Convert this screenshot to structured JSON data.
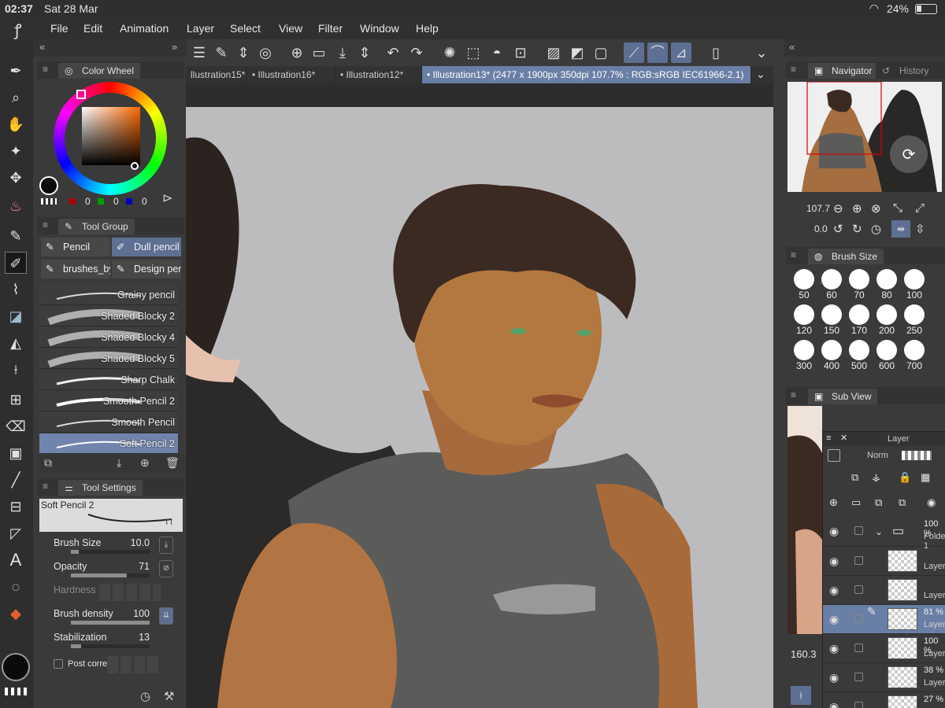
{
  "status": {
    "time": "02:37",
    "date": "Sat 28 Mar",
    "battery": "24%"
  },
  "menu": [
    "File",
    "Edit",
    "Animation",
    "Layer",
    "Select",
    "View",
    "Filter",
    "Window",
    "Help"
  ],
  "tabs": [
    "llustration15*",
    "Illustration16*",
    "Illustration12*",
    "Illustration13* (2477 x 1900px 350dpi 107.7% : RGB:sRGB IEC61966-2.1)"
  ],
  "color_wheel": {
    "title": "Color Wheel",
    "r": "0",
    "g": "0",
    "b": "0",
    "r_color": "#b00000",
    "g_color": "#00a000",
    "b_color": "#0000c0",
    "main_color": "#0b0b0b"
  },
  "tool_group": {
    "title": "Tool Group",
    "items": [
      "Pencil",
      "Dull pencil",
      "brushes_by",
      "Design pen"
    ],
    "brushes": [
      "Grainy pencil",
      "Shaded Blocky 2",
      "Shaded Blocky 4",
      "Shaded Blocky 5",
      "Sharp Chalk",
      "Smooth Pencil 2",
      "Smooth Pencil",
      "Soft Pencil 2"
    ]
  },
  "tool_settings": {
    "title": "Tool Settings",
    "preview_name": "Soft Pencil 2",
    "brush_size_label": "Brush Size",
    "brush_size": "10.0",
    "brush_size_frac": 0.1,
    "opacity_label": "Opacity",
    "opacity": "71",
    "opacity_frac": 0.71,
    "hardness_label": "Hardness",
    "density_label": "Brush density",
    "density": "100",
    "density_frac": 1.0,
    "stabilization_label": "Stabilization",
    "stabilization": "13",
    "stabilization_frac": 0.13,
    "post_label": "Post correc"
  },
  "navigator": {
    "title": "Navigator",
    "history": "History",
    "zoom": "107.7",
    "angle": "0.0"
  },
  "brush_size_panel": {
    "title": "Brush Size",
    "sizes": [
      "50",
      "60",
      "70",
      "80",
      "100",
      "120",
      "150",
      "170",
      "200",
      "250",
      "300",
      "400",
      "500",
      "600",
      "700"
    ]
  },
  "sub_view": {
    "title": "Sub View",
    "value": "160.3"
  },
  "layers": {
    "title": "Layer",
    "blend": "Norm",
    "folder": {
      "pct": "100 %",
      "name": "Folder 1"
    },
    "rows": [
      {
        "pct": "",
        "name": "Layer"
      },
      {
        "pct": "",
        "name": "Layer"
      },
      {
        "pct": "81 %",
        "name": "Layer"
      },
      {
        "pct": "100 %",
        "name": "Layer"
      },
      {
        "pct": "38 %",
        "name": "Layer"
      },
      {
        "pct": "27 %",
        "name": ""
      }
    ]
  }
}
